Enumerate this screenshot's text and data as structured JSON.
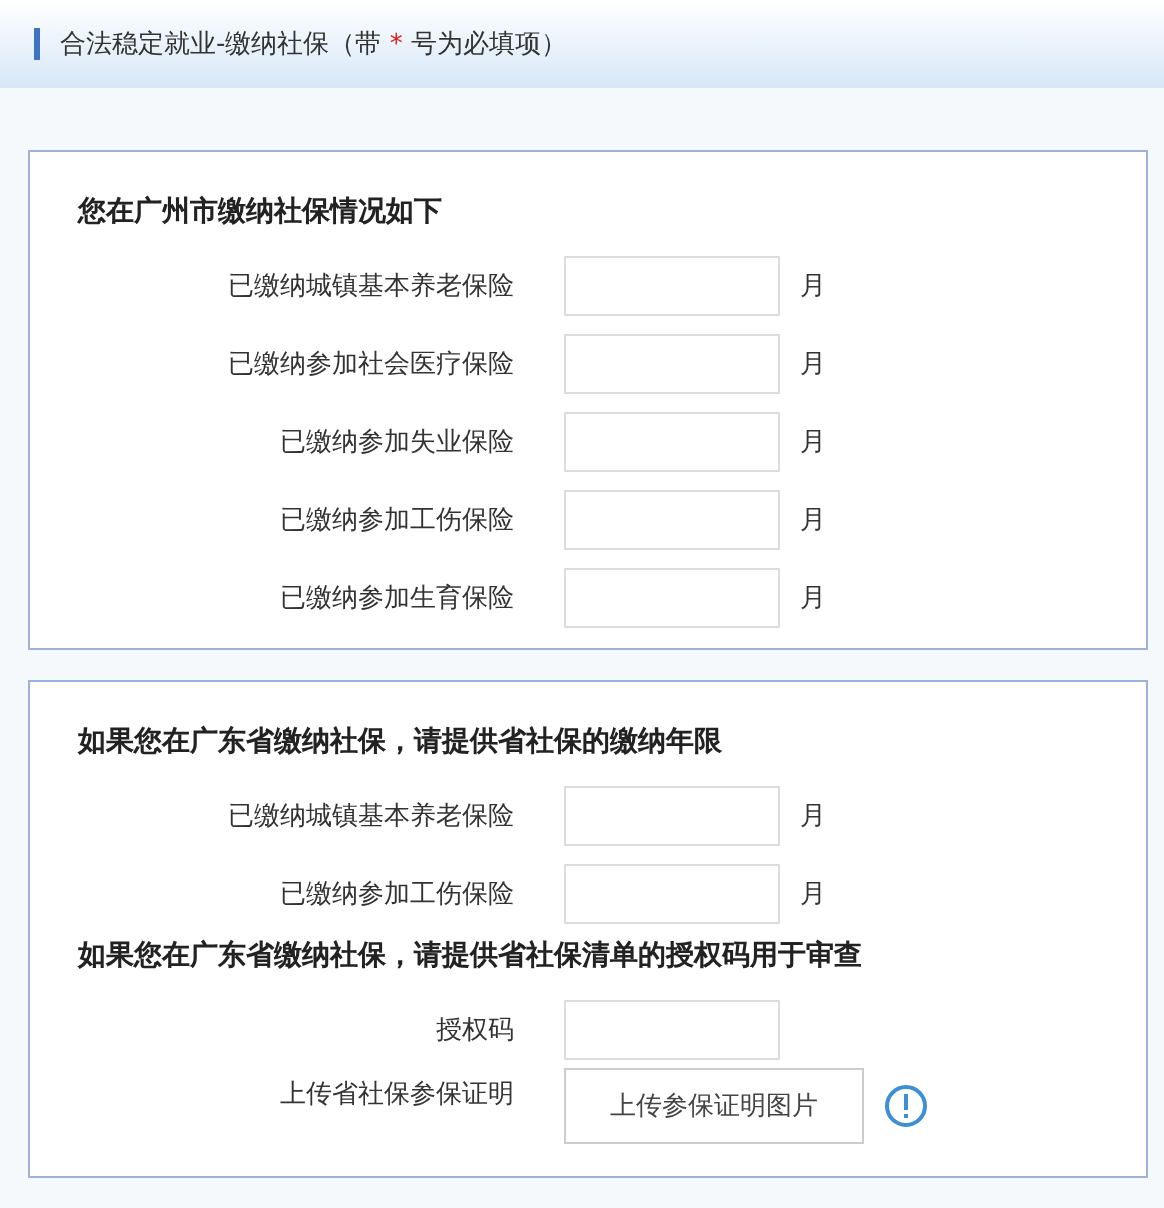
{
  "header": {
    "title_before": "合法稳定就业-缴纳社保（带",
    "required_mark": "*",
    "title_after": "号为必填项）"
  },
  "sections": [
    {
      "items": [
        {
          "kind": "heading",
          "text": "您在广州市缴纳社保情况如下"
        },
        {
          "kind": "field",
          "label": "已缴纳城镇基本养老保险",
          "unit": "月"
        },
        {
          "kind": "field",
          "label": "已缴纳参加社会医疗保险",
          "unit": "月"
        },
        {
          "kind": "field",
          "label": "已缴纳参加失业保险",
          "unit": "月"
        },
        {
          "kind": "field",
          "label": "已缴纳参加工伤保险",
          "unit": "月"
        },
        {
          "kind": "field",
          "label": "已缴纳参加生育保险",
          "unit": "月"
        }
      ]
    },
    {
      "items": [
        {
          "kind": "heading",
          "text": "如果您在广东省缴纳社保，请提供省社保的缴纳年限"
        },
        {
          "kind": "field",
          "label": "已缴纳城镇基本养老保险",
          "unit": "月"
        },
        {
          "kind": "field",
          "label": "已缴纳参加工伤保险",
          "unit": "月"
        },
        {
          "kind": "heading",
          "text": "如果您在广东省缴纳社保，请提供省社保清单的授权码用于审查"
        },
        {
          "kind": "field",
          "label": "授权码"
        },
        {
          "kind": "upload",
          "label": "上传省社保参保证明",
          "button": "上传参保证明图片",
          "info": true
        }
      ]
    }
  ]
}
